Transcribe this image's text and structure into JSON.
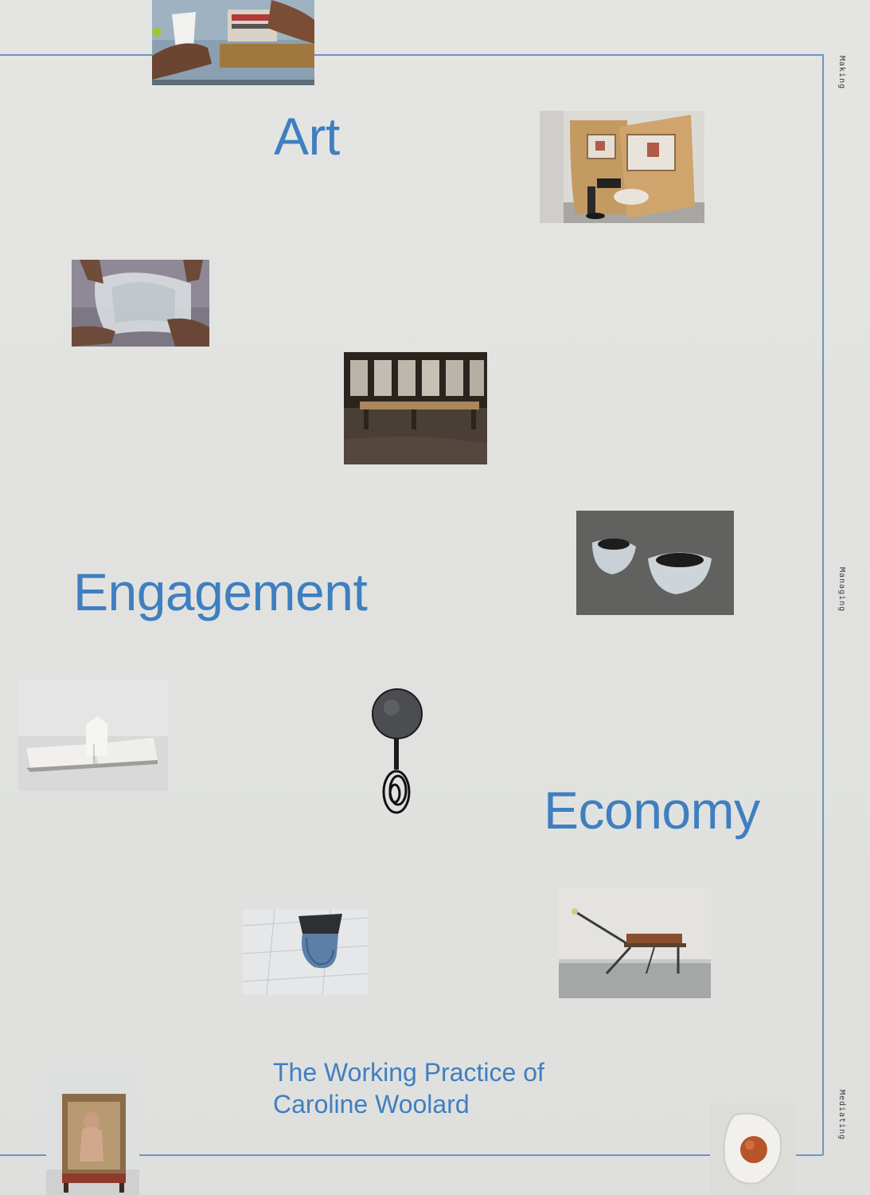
{
  "cover": {
    "title_line1": "Art",
    "title_line2": "Engagement",
    "title_line3": "Economy",
    "subtitle_line1": "The Working Practice of",
    "subtitle_line2": "Caroline Woolard",
    "side_labels": [
      "Making",
      "Managing",
      "Mediating"
    ]
  },
  "colors": {
    "title_blue": "#3f7fc0",
    "frame_blue": "#6a95c4",
    "background": "#e3e4e2"
  }
}
